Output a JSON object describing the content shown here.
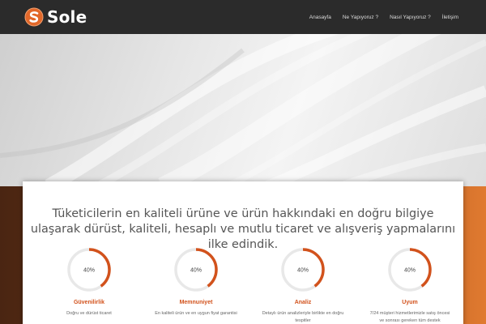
{
  "brand": {
    "name": "Sole",
    "accent": "#d2521c"
  },
  "nav": {
    "items": [
      {
        "label": "Anasayfa"
      },
      {
        "label": "Ne Yapıyoruz ?"
      },
      {
        "label": "Nasıl Yapıyoruz ?"
      },
      {
        "label": "İletişim"
      }
    ]
  },
  "intro": {
    "tagline": "Tüketicilerin en kaliteli ürüne ve ürün hakkındaki en doğru bilgiye ulaşarak dürüst, kaliteli, hesaplı ve mutlu ticaret ve alışveriş yapmalarını ilke edindik."
  },
  "features": [
    {
      "title": "Güvenilirlik",
      "progress_label": "40%",
      "progress": 0.4,
      "description": "Doğru ve dürüst ticaret"
    },
    {
      "title": "Memnuniyet",
      "progress_label": "40%",
      "progress": 0.4,
      "description": "En kaliteli ürün ve en uygun fiyat garantisi"
    },
    {
      "title": "Analiz",
      "progress_label": "40%",
      "progress": 0.4,
      "description": "Detaylı ürün analizleriyle birlikte en doğru tespitler"
    },
    {
      "title": "Uyum",
      "progress_label": "40%",
      "progress": 0.4,
      "description": "7/24 müşteri hizmetlerimizle satış öncesi ve sonrası gereken tüm destek"
    }
  ]
}
